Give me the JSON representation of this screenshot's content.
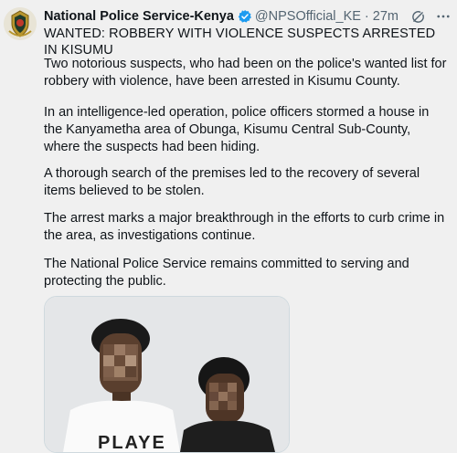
{
  "tweet": {
    "author_name": "National Police Service-Kenya",
    "handle": "@NPSOfficial_KE",
    "separator": "·",
    "time": "27m",
    "headline": "WANTED: ROBBERY WITH VIOLENCE SUSPECTS ARRESTED IN KISUMU",
    "paragraphs": [
      "Two notorious suspects, who had been on the police's wanted list for robbery with violence, have been arrested in Kisumu County.",
      "In an intelligence-led operation, police officers stormed a house in the Kanyametha area of Obunga, Kisumu Central Sub-County, where the suspects had been hiding.",
      "A thorough search of the premises led to the recovery of several items believed to be stolen.",
      "The arrest marks a major breakthrough in the efforts to curb crime in the area, as investigations continue.",
      "The National Police Service remains committed to serving and protecting the public."
    ],
    "media_shirt_text": "PLAYE"
  },
  "icons": {
    "verified": "verified-badge-icon",
    "grok": "grok-icon",
    "more": "more-icon"
  },
  "colors": {
    "background": "#f0f0f0",
    "text": "#0f1419",
    "secondary": "#536471",
    "verified": "#1d9bf0"
  }
}
